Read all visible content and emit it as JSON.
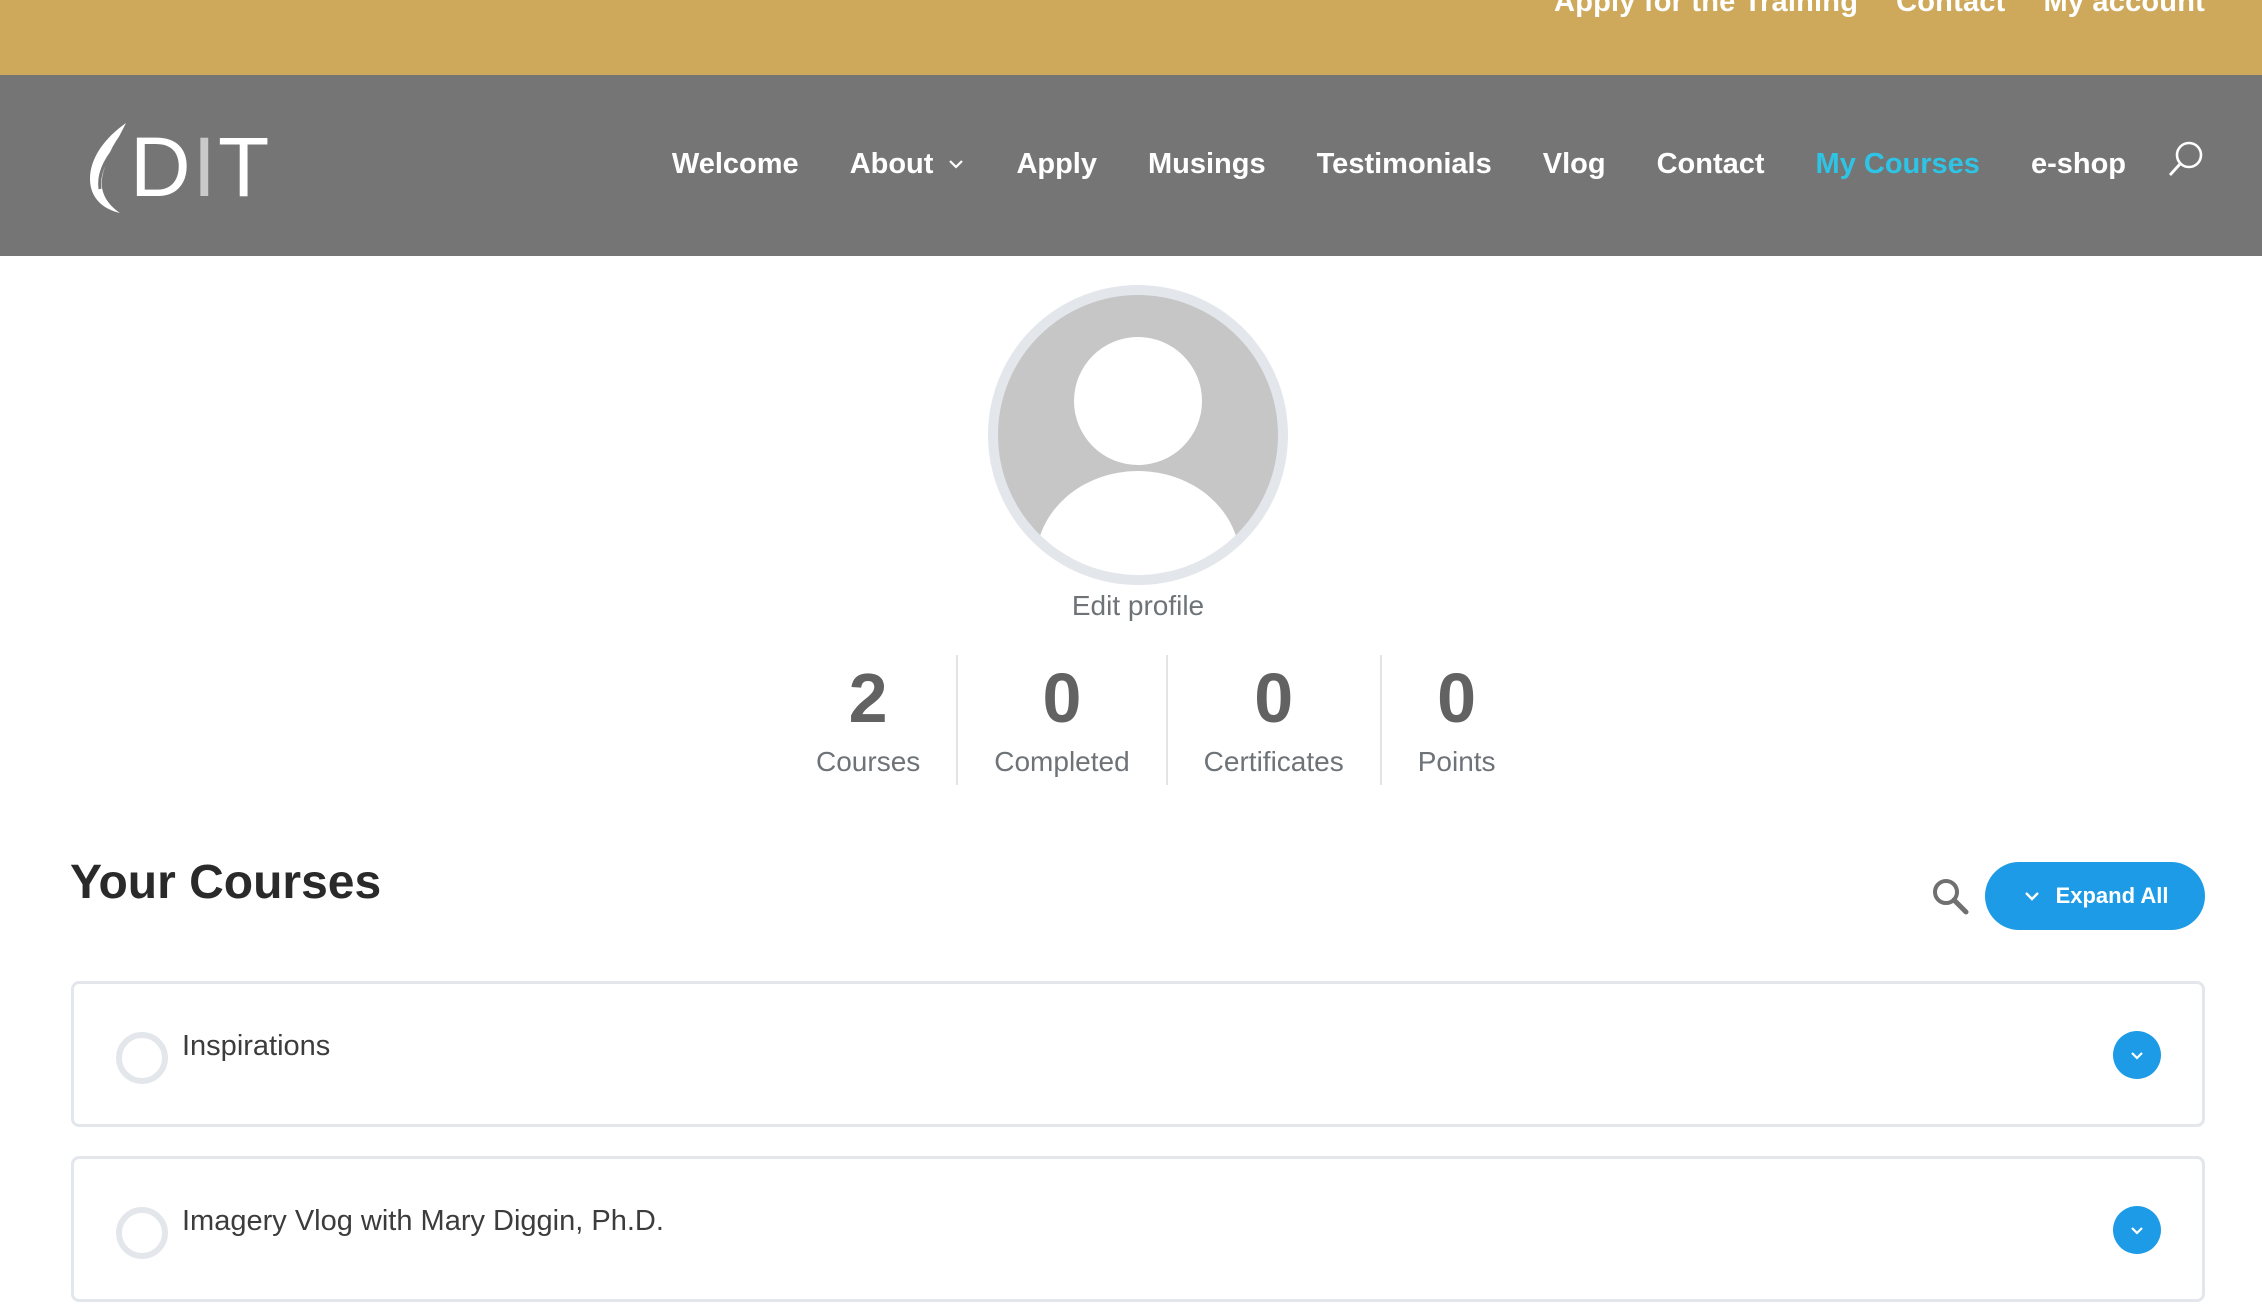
{
  "topbar": {
    "links": [
      "Apply for the Training",
      "Contact",
      "My account"
    ]
  },
  "logo": {
    "text_main": "D",
    "text_dim": "I",
    "text_end": "T"
  },
  "nav": {
    "items": [
      {
        "label": "Welcome"
      },
      {
        "label": "About",
        "has_dropdown": true
      },
      {
        "label": "Apply"
      },
      {
        "label": "Musings"
      },
      {
        "label": "Testimonials"
      },
      {
        "label": "Vlog"
      },
      {
        "label": "Contact"
      },
      {
        "label": "My Courses",
        "active": true
      },
      {
        "label": "e-shop"
      }
    ],
    "search_icon": "search-icon",
    "active_color": "#2ec4e6"
  },
  "profile": {
    "edit_label": "Edit profile",
    "stats": [
      {
        "value": "2",
        "label": "Courses"
      },
      {
        "value": "0",
        "label": "Completed"
      },
      {
        "value": "0",
        "label": "Certificates"
      },
      {
        "value": "0",
        "label": "Points"
      }
    ]
  },
  "courses": {
    "title": "Your Courses",
    "expand_label": "Expand All",
    "items": [
      {
        "title": "Inspirations"
      },
      {
        "title": "Imagery Vlog with Mary Diggin, Ph.D."
      }
    ]
  },
  "colors": {
    "topbar": "#cfa95b",
    "header": "#757575",
    "accent": "#1d9be6"
  }
}
